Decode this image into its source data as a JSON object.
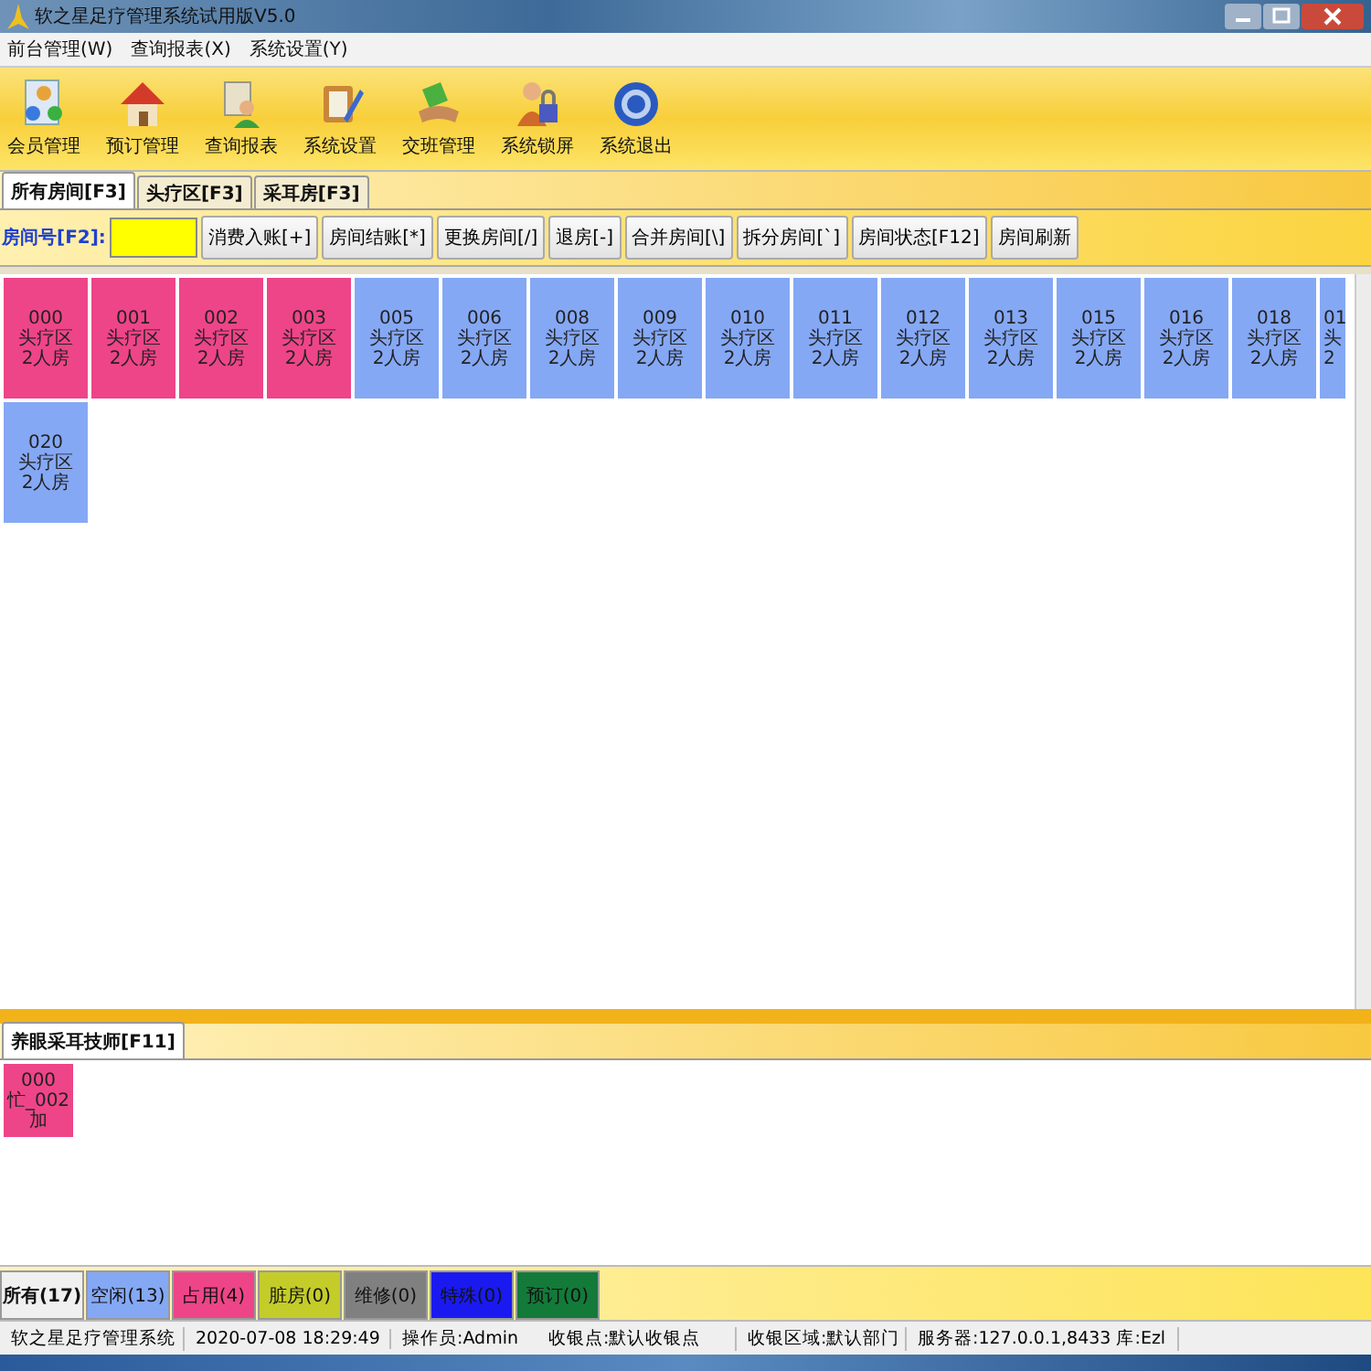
{
  "window": {
    "title": "软之星足疗管理系统试用版V5.0"
  },
  "menu": [
    "前台管理(W)",
    "查询报表(X)",
    "系统设置(Y)"
  ],
  "toolbar": [
    {
      "label": "会员管理",
      "kind": "members"
    },
    {
      "label": "预订管理",
      "kind": "house"
    },
    {
      "label": "查询报表",
      "kind": "report"
    },
    {
      "label": "系统设置",
      "kind": "settings"
    },
    {
      "label": "交班管理",
      "kind": "handover"
    },
    {
      "label": "系统锁屏",
      "kind": "lock"
    },
    {
      "label": "系统退出",
      "kind": "exit"
    }
  ],
  "area_tabs": [
    {
      "label": "所有房间[F3]",
      "selected": true
    },
    {
      "label": "头疗区[F3]",
      "selected": false
    },
    {
      "label": "采耳房[F3]",
      "selected": false
    }
  ],
  "room_field": {
    "label": "房间号[F2]:"
  },
  "actions": [
    "消费入账[+]",
    "房间结账[*]",
    "更换房间[/]",
    "退房[-]",
    "合并房间[\\]",
    "拆分房间[`]",
    "房间状态[F12]",
    "房间刷新"
  ],
  "rooms": [
    {
      "number": "000",
      "area": "头疗区",
      "type": "2人房",
      "color": "#ee4588"
    },
    {
      "number": "001",
      "area": "头疗区",
      "type": "2人房",
      "color": "#ee4588"
    },
    {
      "number": "002",
      "area": "头疗区",
      "type": "2人房",
      "color": "#ee4588"
    },
    {
      "number": "003",
      "area": "头疗区",
      "type": "2人房",
      "color": "#ee4588"
    },
    {
      "number": "005",
      "area": "头疗区",
      "type": "2人房",
      "color": "#85a8f5"
    },
    {
      "number": "006",
      "area": "头疗区",
      "type": "2人房",
      "color": "#85a8f5"
    },
    {
      "number": "008",
      "area": "头疗区",
      "type": "2人房",
      "color": "#85a8f5"
    },
    {
      "number": "009",
      "area": "头疗区",
      "type": "2人房",
      "color": "#85a8f5"
    },
    {
      "number": "010",
      "area": "头疗区",
      "type": "2人房",
      "color": "#85a8f5"
    },
    {
      "number": "011",
      "area": "头疗区",
      "type": "2人房",
      "color": "#85a8f5"
    },
    {
      "number": "012",
      "area": "头疗区",
      "type": "2人房",
      "color": "#85a8f5"
    },
    {
      "number": "013",
      "area": "头疗区",
      "type": "2人房",
      "color": "#85a8f5"
    },
    {
      "number": "015",
      "area": "头疗区",
      "type": "2人房",
      "color": "#85a8f5"
    },
    {
      "number": "016",
      "area": "头疗区",
      "type": "2人房",
      "color": "#85a8f5"
    },
    {
      "number": "018",
      "area": "头疗区",
      "type": "2人房",
      "color": "#85a8f5"
    },
    {
      "number": "01",
      "area": "头",
      "type": "2",
      "color": "#85a8f5",
      "cut": true
    },
    {
      "number": "020",
      "area": "头疗区",
      "type": "2人房",
      "color": "#85a8f5"
    }
  ],
  "tech_tab": {
    "label": "养眼采耳技师[F11]",
    "selected": true
  },
  "technicians": [
    {
      "number": "000",
      "line": "忙_002",
      "note": "加",
      "color": "#ee4588"
    }
  ],
  "filters": [
    {
      "label": "所有(17)",
      "color": "#f0f0f0",
      "selected": true
    },
    {
      "label": "空闲(13)",
      "color": "#85a8f5",
      "selected": false
    },
    {
      "label": "占用(4)",
      "color": "#ee4588",
      "selected": false
    },
    {
      "label": "脏房(0)",
      "color": "#c4cc2a",
      "selected": false
    },
    {
      "label": "维修(0)",
      "color": "#808080",
      "selected": false
    },
    {
      "label": "特殊(0)",
      "color": "#1a1af0",
      "selected": false
    },
    {
      "label": "预订(0)",
      "color": "#137a3a",
      "selected": false
    }
  ],
  "status_bar": [
    "软之星足疗管理系统",
    "2020-07-08 18:29:49",
    "操作员:Admin",
    "收银点:默认收银点",
    "收银区域:默认部门",
    "服务器:127.0.0.1,8433 库:Ezl"
  ]
}
